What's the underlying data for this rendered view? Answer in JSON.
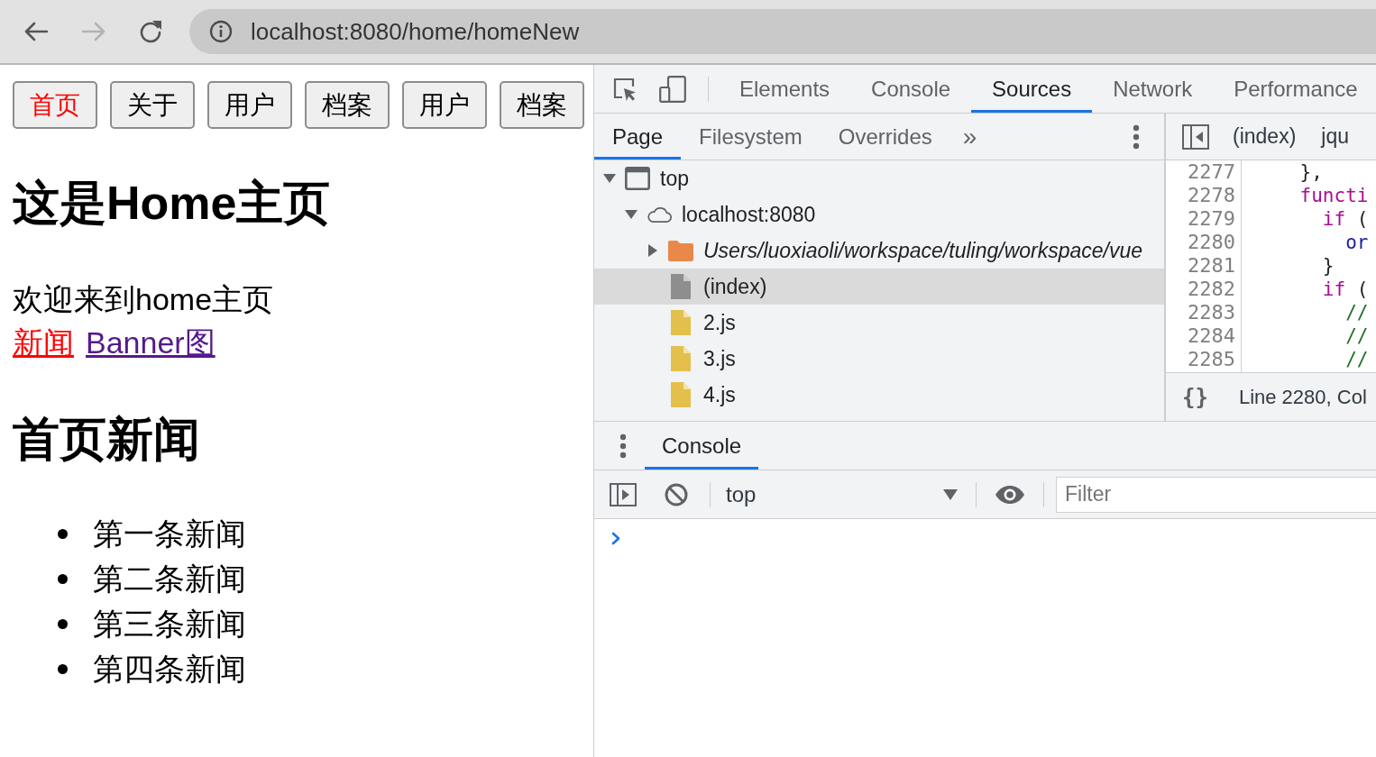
{
  "browser": {
    "nav": [
      {
        "kind": "back",
        "disabled": false
      },
      {
        "kind": "forward",
        "disabled": true
      },
      {
        "kind": "reload",
        "disabled": false
      }
    ],
    "url": "localhost:8080/home/homeNew"
  },
  "page": {
    "nav_buttons": [
      {
        "label": "首页",
        "selected": true
      },
      {
        "label": "关于",
        "selected": false
      },
      {
        "label": "用户",
        "selected": false
      },
      {
        "label": "档案",
        "selected": false
      },
      {
        "label": "用户",
        "selected": false
      },
      {
        "label": "档案",
        "selected": false
      }
    ],
    "heading": "这是Home主页",
    "welcome": "欢迎来到home主页",
    "links": [
      {
        "label": "新闻",
        "selected": true
      },
      {
        "label": "Banner图",
        "selected": false
      }
    ],
    "news_heading": "首页新闻",
    "news": [
      "第一条新闻",
      "第二条新闻",
      "第三条新闻",
      "第四条新闻"
    ]
  },
  "devtools": {
    "tabs": [
      {
        "label": "Elements",
        "selected": false
      },
      {
        "label": "Console",
        "selected": false
      },
      {
        "label": "Sources",
        "selected": true
      },
      {
        "label": "Network",
        "selected": false
      },
      {
        "label": "Performance",
        "selected": false
      }
    ],
    "sources": {
      "tabs": [
        {
          "label": "Page",
          "selected": true
        },
        {
          "label": "Filesystem",
          "selected": false
        },
        {
          "label": "Overrides",
          "selected": false
        }
      ],
      "more_tabs": "»",
      "tree": [
        {
          "label": "top",
          "kind": "frame",
          "expanded": true,
          "selected": false,
          "children": [
            {
              "label": "localhost:8080",
              "kind": "origin",
              "expanded": true,
              "selected": false,
              "children": [
                {
                  "label": "Users/luoxiaoli/workspace/tuling/workspace/vue",
                  "kind": "folder",
                  "expanded": false,
                  "selected": false
                },
                {
                  "label": "(index)",
                  "kind": "document",
                  "selected": true
                },
                {
                  "label": "2.js",
                  "kind": "script",
                  "selected": false
                },
                {
                  "label": "3.js",
                  "kind": "script",
                  "selected": false
                },
                {
                  "label": "4.js",
                  "kind": "script",
                  "selected": false
                }
              ]
            }
          ]
        }
      ]
    },
    "editor": {
      "tabs": [
        "(index)",
        "jqu"
      ],
      "lines": [
        {
          "number": "2277",
          "tokens": [
            {
              "kind": "plain",
              "text": "    },"
            }
          ]
        },
        {
          "number": "2278",
          "tokens": [
            {
              "kind": "keyword",
              "text": "    functi"
            }
          ]
        },
        {
          "number": "2279",
          "tokens": [
            {
              "kind": "keyword",
              "text": "      if"
            },
            {
              "kind": "plain",
              "text": " ("
            }
          ]
        },
        {
          "number": "2280",
          "tokens": [
            {
              "kind": "name",
              "text": "        or"
            }
          ]
        },
        {
          "number": "2281",
          "tokens": [
            {
              "kind": "plain",
              "text": "      }"
            }
          ]
        },
        {
          "number": "2282",
          "tokens": [
            {
              "kind": "keyword",
              "text": "      if"
            },
            {
              "kind": "plain",
              "text": " ("
            }
          ]
        },
        {
          "number": "2283",
          "tokens": [
            {
              "kind": "comment",
              "text": "        //"
            }
          ]
        },
        {
          "number": "2284",
          "tokens": [
            {
              "kind": "comment",
              "text": "        //"
            }
          ]
        },
        {
          "number": "2285",
          "tokens": [
            {
              "kind": "comment",
              "text": "        //"
            }
          ]
        }
      ],
      "pretty_print": "{}",
      "status": "Line 2280, Col"
    },
    "drawer": {
      "tabs": [
        {
          "label": "Console",
          "selected": true
        }
      ],
      "context": "top",
      "filter": {
        "placeholder": "Filter"
      }
    }
  }
}
